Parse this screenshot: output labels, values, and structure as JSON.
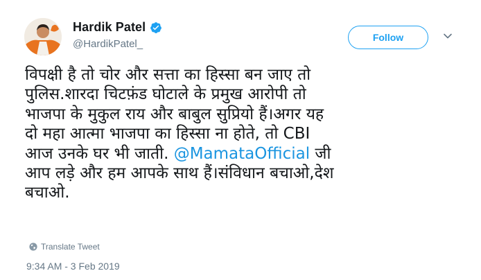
{
  "user": {
    "display_name": "Hardik Patel",
    "handle": "@HardikPatel_",
    "verified": true
  },
  "actions": {
    "follow_label": "Follow"
  },
  "tweet": {
    "lines": [
      "विपक्षी है तो चोर और सत्ता का हिस्सा बन जाए तो",
      "पुलिस.शारदा चिटफ़ंड घोटाले के प्रमुख आरोपी तो",
      "भाजपा के मुकुल राय और बाबुल सुप्रियो हैं।अगर यह",
      "दो महा आत्मा भाजपा का हिस्सा ना होते, तो CBI"
    ],
    "line5_before": "आज उनके घर भी जाती. ",
    "mention": "@MamataOfficial",
    "line5_after": " जी",
    "line6": "आप लड़े और हम आपके साथ हैं।संविधान बचाओ,देश",
    "line7": "बचाओ."
  },
  "translate_label": "Translate Tweet",
  "timestamp": "9:34 AM - 3 Feb 2019",
  "colors": {
    "link": "#1b95e0",
    "brand": "#1da1f2",
    "secondary_text": "#657786",
    "primary_text": "#14171a"
  },
  "icons": [
    "verified-badge-icon",
    "chevron-down-icon",
    "globe-icon"
  ]
}
